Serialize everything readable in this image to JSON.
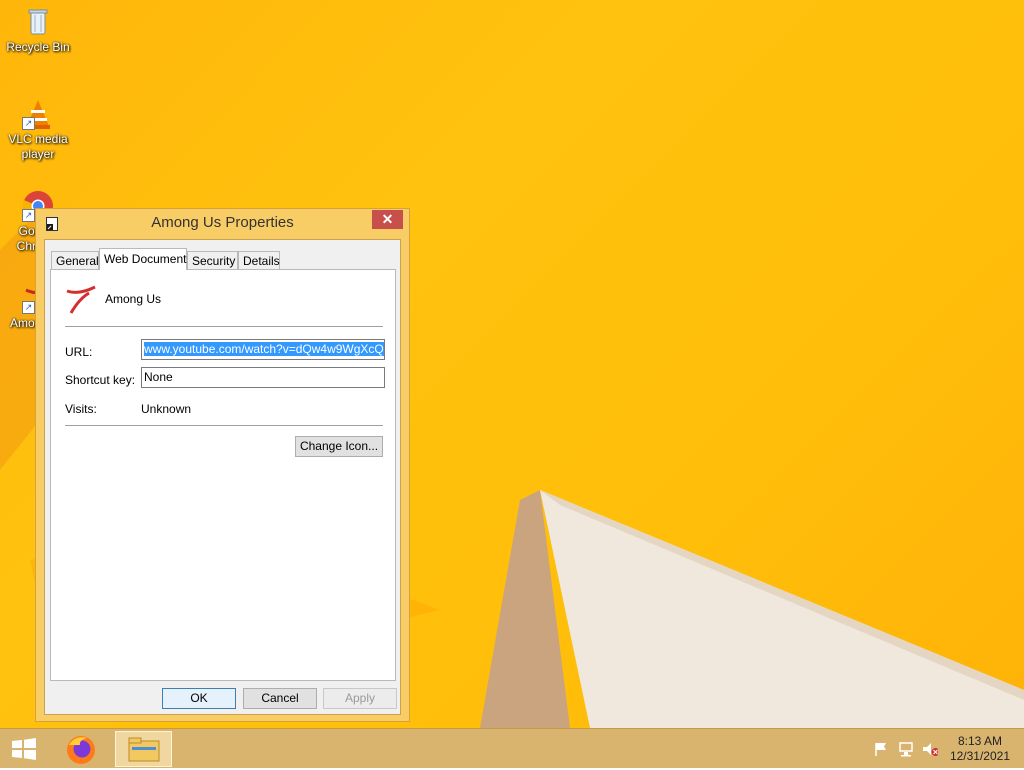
{
  "desktop": {
    "icons": [
      {
        "label": "Recycle Bin"
      },
      {
        "label": "VLC media player"
      },
      {
        "label": "Google Chrome"
      },
      {
        "label": "Among Us"
      }
    ]
  },
  "dialog": {
    "title": "Among Us Properties",
    "close_label": "✕",
    "tabs": [
      "General",
      "Web Document",
      "Security",
      "Details"
    ],
    "active_tab": "Web Document",
    "item_name": "Among Us",
    "url_label": "URL:",
    "url_value": "www.youtube.com/watch?v=dQw4w9WgXcQ",
    "shortcut_label": "Shortcut key:",
    "shortcut_value": "None",
    "visits_label": "Visits:",
    "visits_value": "Unknown",
    "change_icon_label": "Change Icon...",
    "ok_label": "OK",
    "cancel_label": "Cancel",
    "apply_label": "Apply"
  },
  "taskbar": {
    "time": "8:13 AM",
    "date": "12/31/2021",
    "pinned": [
      "firefox-icon",
      "file-explorer-icon"
    ]
  },
  "colors": {
    "wallpaper": "#ffbe0a",
    "dialog_frame": "#f9cd66",
    "close_button": "#c7504b",
    "taskbar": "#d8b46f",
    "selection": "#3399ff"
  }
}
